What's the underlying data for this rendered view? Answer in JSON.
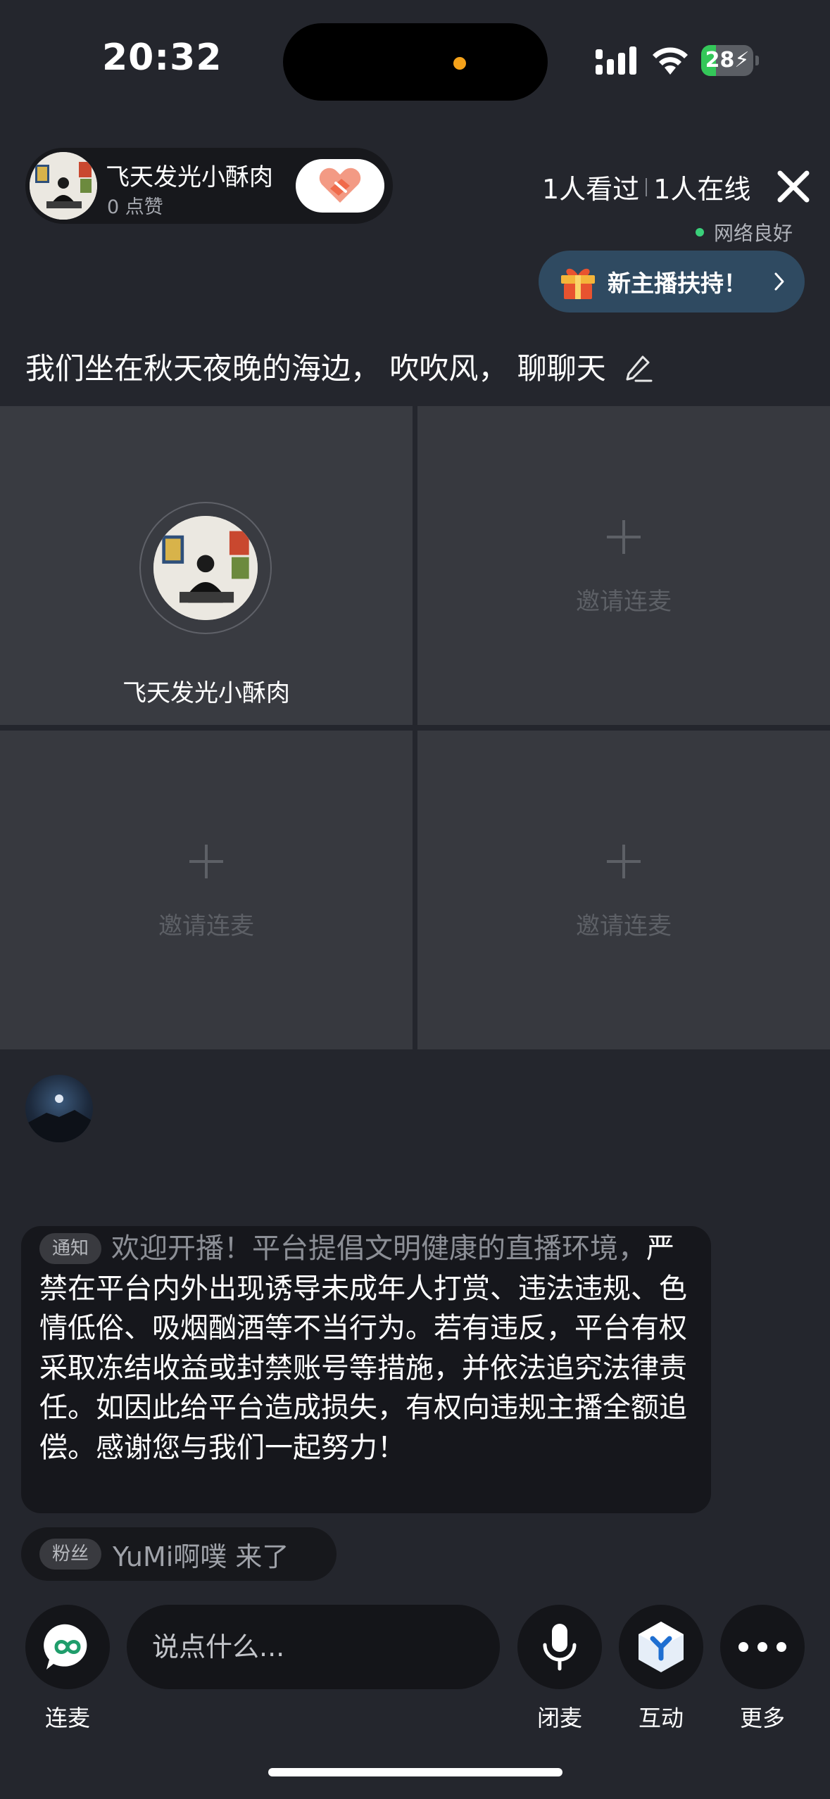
{
  "status_bar": {
    "time": "20:32",
    "battery_level": "28",
    "battery_fraction": 0.28
  },
  "host": {
    "name": "飞天发光小酥肉",
    "likes": "0 点赞",
    "follow_icon": "heart-handshake-icon"
  },
  "stats": {
    "viewed": "1人看过",
    "online": "1人在线"
  },
  "network": {
    "status": "网络良好",
    "color": "#3ad07a"
  },
  "support_button": {
    "label": "新主播扶持！",
    "icon": "gift-icon"
  },
  "topic": {
    "text": "我们坐在秋天夜晚的海边， 吹吹风， 聊聊天",
    "icon": "edit-icon"
  },
  "mic_seats": [
    {
      "occupied": true,
      "name": "飞天发光小酥肉"
    },
    {
      "occupied": false,
      "label": "邀请连麦"
    },
    {
      "occupied": false,
      "label": "邀请连麦"
    },
    {
      "occupied": false,
      "label": "邀请连麦"
    }
  ],
  "chat": {
    "notice": {
      "tag": "通知",
      "first_line": "欢迎开播！平台提倡文明健康的直播环境，",
      "body": "严禁在平台内外出现诱导未成年人打赏、违法违规、色情低俗、吸烟酗酒等不当行为。若有违反，平台有权采取冻结收益或封禁账号等措施，并依法追究法律责任。如因此给平台造成损失，有权向违规主播全额追偿。感谢您与我们一起努力！"
    },
    "join_message": {
      "tag": "粉丝",
      "text": "YuMi啊噗 来了"
    }
  },
  "bottom_bar": {
    "input_placeholder": "说点什么...",
    "connect_label": "连麦",
    "mute_label": "闭麦",
    "interact_label": "互动",
    "more_label": "更多"
  },
  "colors": {
    "background": "#24262d",
    "accent_green": "#3ad07a",
    "support_button_bg": "#2f4a61",
    "follow_heart": "#f06a4a"
  }
}
